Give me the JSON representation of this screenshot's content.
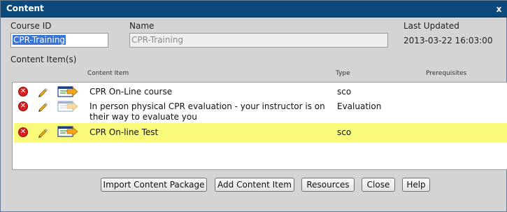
{
  "window": {
    "title": "Content",
    "close_glyph": "x"
  },
  "header": {
    "course_id_label": "Course ID",
    "course_id_value": "CPR-Training",
    "name_label": "Name",
    "name_value": "CPR-Training",
    "last_updated_label": "Last Updated",
    "last_updated_value": "2013-03-22 16:03:00"
  },
  "content_items": {
    "section_label": "Content Item(s)",
    "columns": {
      "item": "Content Item",
      "type": "Type",
      "prerequisites": "Prerequisites"
    },
    "rows": [
      {
        "title": "CPR On-Line course",
        "type": "sco",
        "prerequisites": "",
        "highlighted": false,
        "launch_enabled": true
      },
      {
        "title_line1": "In person physical CPR evaluation - your instructor is on",
        "title_line2": "their way to evaluate you",
        "type": "Evaluation",
        "prerequisites": "",
        "highlighted": false,
        "launch_enabled": false
      },
      {
        "title": "CPR On-line Test",
        "type": "sco",
        "prerequisites": "",
        "highlighted": true,
        "launch_enabled": true
      }
    ],
    "row_icons": [
      "delete-icon",
      "pencil-icon",
      "launch-arrow-icon"
    ]
  },
  "buttons": {
    "import": "Import Content Package",
    "add": "Add Content Item",
    "resources": "Resources",
    "close": "Close",
    "help": "Help"
  },
  "colors": {
    "titlebar": "#0c4a7c",
    "dialog_bg": "#d4d4d4",
    "highlight_row": "#fafa7a",
    "delete_red": "#d81e1e",
    "selection_blue": "#3875d7"
  }
}
